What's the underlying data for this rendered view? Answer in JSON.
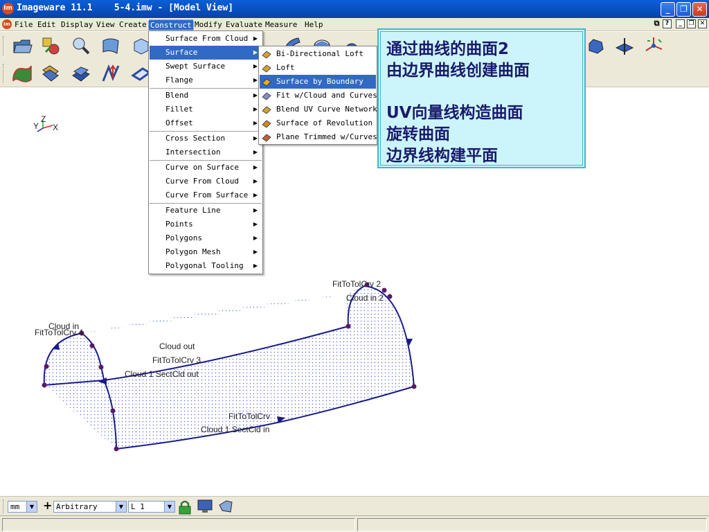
{
  "window": {
    "title": "Imageware 11.1    5-4.imw - [Model View]",
    "app_icon": "Im"
  },
  "menubar": {
    "items": [
      "File",
      "Edit",
      "Display",
      "View",
      "Create",
      "Construct",
      "Modify",
      "Evaluate",
      "Measure",
      "Help"
    ],
    "active": "Construct"
  },
  "construct_menu": {
    "items": [
      {
        "label": "Surface From Cloud",
        "sub": true
      },
      {
        "label": "Surface",
        "sub": true,
        "selected": true
      },
      {
        "label": "Swept Surface",
        "sub": true
      },
      {
        "label": "Flange",
        "sub": true
      },
      {
        "label": "Blend",
        "sub": true
      },
      {
        "label": "Fillet",
        "sub": true
      },
      {
        "label": "Offset",
        "sub": true
      },
      {
        "label": "Cross Section",
        "sub": true
      },
      {
        "label": "Intersection",
        "sub": true
      },
      {
        "label": "Curve on Surface",
        "sub": true
      },
      {
        "label": "Curve From Cloud",
        "sub": true
      },
      {
        "label": "Curve From Surface",
        "sub": true
      },
      {
        "label": "Feature Line",
        "sub": true
      },
      {
        "label": "Points",
        "sub": true
      },
      {
        "label": "Polygons",
        "sub": true
      },
      {
        "label": "Polygon Mesh",
        "sub": true
      },
      {
        "label": "Polygonal Tooling",
        "sub": true
      }
    ]
  },
  "surface_submenu": {
    "items": [
      {
        "label": "Bi-Directional Loft",
        "icon": "bi-directional-loft-icon"
      },
      {
        "label": "Loft",
        "icon": "loft-icon"
      },
      {
        "label": "Surface by Boundary",
        "icon": "surface-by-boundary-icon",
        "selected": true
      },
      {
        "label": "Fit w/Cloud and Curves",
        "icon": "fit-cloud-curves-icon"
      },
      {
        "label": "Blend UV Curve Network",
        "icon": "blend-uv-network-icon"
      },
      {
        "label": "Surface of Revolution",
        "icon": "surface-revolution-icon"
      },
      {
        "label": "Plane Trimmed w/Curves",
        "icon": "plane-trimmed-icon"
      }
    ]
  },
  "callout": {
    "lines": [
      "通过曲线的曲面2",
      "由边界曲线创建曲面",
      "",
      "UV向量线构造曲面",
      "旋转曲面",
      "边界线构建平面"
    ]
  },
  "axis_triad": {
    "x": "X",
    "y": "Y",
    "z": "Z"
  },
  "canvas_labels": {
    "fit2": "FitToTolCrv 2",
    "cloud_in2": "Cloud in 2",
    "cloud_in": "Cloud in",
    "fit4": "FitToTolCrv 4",
    "cloud_out": "Cloud out",
    "fit3": "FitToTolCrv 3",
    "sect_out": "Cloud 1 SectCld out",
    "fit": "FitToTolCrv",
    "sect_in": "Cloud 1 SectCld in"
  },
  "statusbar": {
    "units": "mm",
    "view_mode": "Arbitrary",
    "layer": "L 1"
  },
  "colors": {
    "title_blue": "#0a5fd8",
    "menu_select": "#316ac5",
    "callout_bg": "#ccf5fb",
    "curve_color": "#1a1a8a",
    "point_color": "#5a1a6a"
  }
}
